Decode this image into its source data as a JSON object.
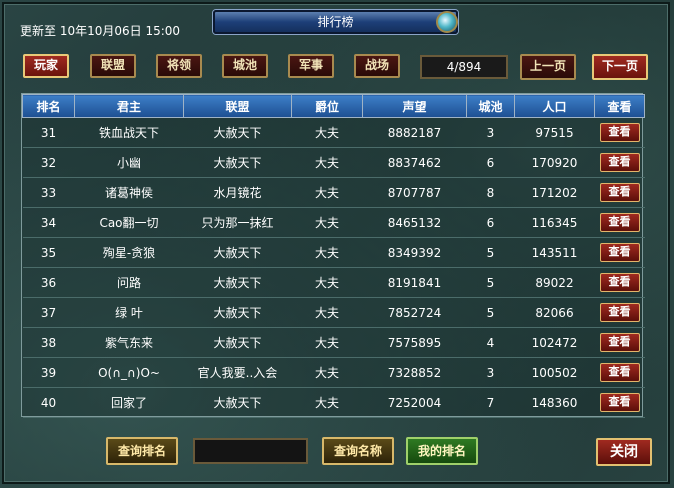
{
  "header": {
    "updated": "更新至  10年10月06日  15:00",
    "title": "排行榜"
  },
  "tabs": [
    {
      "label": "玩家",
      "active": true
    },
    {
      "label": "联盟",
      "active": false
    },
    {
      "label": "将领",
      "active": false
    },
    {
      "label": "城池",
      "active": false
    },
    {
      "label": "军事",
      "active": false
    },
    {
      "label": "战场",
      "active": false
    }
  ],
  "pagination": {
    "page": "4/894",
    "prev_label": "上一页",
    "next_label": "下一页"
  },
  "table": {
    "columns": [
      "排名",
      "君主",
      "联盟",
      "爵位",
      "声望",
      "城池",
      "人口",
      "查看"
    ],
    "view_label": "查看",
    "rows": [
      [
        "31",
        "铁血战天下",
        "大赦天下",
        "大夫",
        "8882187",
        "3",
        "97515"
      ],
      [
        "32",
        "小幽",
        "大赦天下",
        "大夫",
        "8837462",
        "6",
        "170920"
      ],
      [
        "33",
        "诸葛神侯",
        "水月镜花",
        "大夫",
        "8707787",
        "8",
        "171202"
      ],
      [
        "34",
        "Cao翻一切",
        "只为那一抹红",
        "大夫",
        "8465132",
        "6",
        "116345"
      ],
      [
        "35",
        "殉星-贪狼",
        "大赦天下",
        "大夫",
        "8349392",
        "5",
        "143511"
      ],
      [
        "36",
        "问路",
        "大赦天下",
        "大夫",
        "8191841",
        "5",
        "89022"
      ],
      [
        "37",
        "绿  叶",
        "大赦天下",
        "大夫",
        "7852724",
        "5",
        "82066"
      ],
      [
        "38",
        "紫气东来",
        "大赦天下",
        "大夫",
        "7575895",
        "4",
        "102472"
      ],
      [
        "39",
        "O(∩_∩)O~",
        "官人我要..入会",
        "大夫",
        "7328852",
        "3",
        "100502"
      ],
      [
        "40",
        "回家了",
        "大赦天下",
        "大夫",
        "7252004",
        "7",
        "148360"
      ]
    ]
  },
  "bottom": {
    "rank_query_label": "查询排名",
    "rank_input_value": "",
    "name_input_value": "",
    "name_query_label": "查询名称",
    "my_rank_label": "我的排名",
    "close_label": "关闭"
  }
}
